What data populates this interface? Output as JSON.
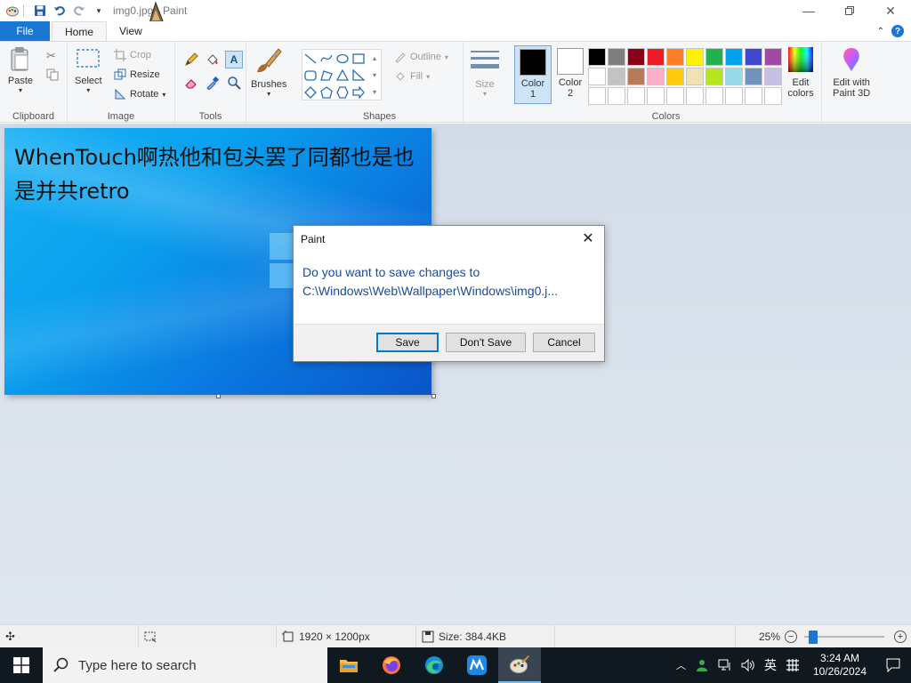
{
  "window": {
    "title": "img0.jpg - Paint",
    "controls": [
      "minimize-icon",
      "restore-icon",
      "close-icon"
    ]
  },
  "quick_access": [
    "save-icon",
    "undo-icon",
    "redo-icon",
    "customize-icon"
  ],
  "tabs": [
    {
      "label": "File"
    },
    {
      "label": "Home"
    },
    {
      "label": "View"
    }
  ],
  "ribbon": {
    "clipboard": {
      "group_label": "Clipboard",
      "paste": "Paste",
      "cut_icon": "scissors-icon",
      "copy_icon": "copy-icon"
    },
    "image": {
      "group_label": "Image",
      "select": "Select",
      "crop": "Crop",
      "resize": "Resize",
      "rotate": "Rotate"
    },
    "tools": {
      "group_label": "Tools",
      "items": [
        "pencil-icon",
        "fill-icon",
        "text-icon",
        "eraser-icon",
        "color-picker-icon",
        "magnifier-icon"
      ],
      "text_tool_glyph": "A"
    },
    "brushes": {
      "label": "Brushes"
    },
    "shapes": {
      "group_label": "Shapes",
      "outline": "Outline",
      "fill": "Fill"
    },
    "size": {
      "label": "Size"
    },
    "colors": {
      "group_label": "Colors",
      "color1": {
        "label": "Color",
        "num": "1",
        "value": "#000000"
      },
      "color2": {
        "label": "Color",
        "num": "2",
        "value": "#ffffff"
      },
      "palette_row1": [
        "#000000",
        "#7f7f7f",
        "#880015",
        "#ed1c24",
        "#ff7f27",
        "#fff200",
        "#22b14c",
        "#00a2e8",
        "#3f48cc",
        "#a349a4"
      ],
      "palette_row2": [
        "#ffffff",
        "#c3c3c3",
        "#b97a57",
        "#ffaec9",
        "#ffc90e",
        "#efe4b0",
        "#b5e61d",
        "#99d9ea",
        "#7092be",
        "#c8bfe7"
      ],
      "palette_row3": [
        "#ffffff",
        "#ffffff",
        "#ffffff",
        "#ffffff",
        "#ffffff",
        "#ffffff",
        "#ffffff",
        "#ffffff",
        "#ffffff",
        "#ffffff"
      ],
      "edit_colors": "Edit colors",
      "edit_colors_l1": "Edit",
      "edit_colors_l2": "colors",
      "paint3d_l1": "Edit with",
      "paint3d_l2": "Paint 3D"
    }
  },
  "canvas": {
    "text_line1": "WhenTouch啊热他和包头罢了同都也是也",
    "text_line2": "是并共retro"
  },
  "dialog": {
    "title": "Paint",
    "message_line1": "Do you want to save changes to",
    "message_line2": "C:\\Windows\\Web\\Wallpaper\\Windows\\img0.j...",
    "buttons": {
      "save": "Save",
      "dont_save": "Don't Save",
      "cancel": "Cancel"
    }
  },
  "statusbar": {
    "dimensions": "1920 × 1200px",
    "size": "Size: 384.4KB",
    "zoom": "25%",
    "zoom_fraction": 0.06
  },
  "taskbar": {
    "search_placeholder": "Type here to search",
    "apps": [
      "file-explorer-icon",
      "firefox-icon",
      "edge-icon",
      "app-icon",
      "paint-icon"
    ],
    "ime": "英",
    "time": "3:24 AM",
    "date": "10/26/2024"
  }
}
